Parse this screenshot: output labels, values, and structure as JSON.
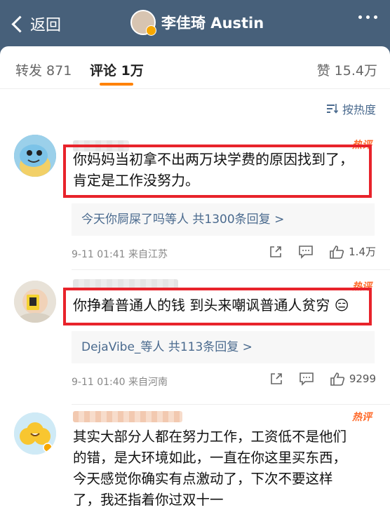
{
  "nav": {
    "back_label": "返回",
    "title": "李佳琦 Austin",
    "more_icon": "more-dots-icon"
  },
  "tabs": {
    "repost": "转发 871",
    "comments": "评论 1万",
    "likes": "赞 15.4万"
  },
  "sort_label": "按热度",
  "comments": [
    {
      "hot_label": "热评",
      "lines": [
        "你妈妈当初拿不出两万块学费的原因找到了，",
        "肯定是工作没努力。"
      ],
      "replies": "今天你屙屎了吗等人  共1300条回复 >",
      "meta": "9-11 01:41  来自江苏",
      "like_count": "1.4万"
    },
    {
      "hot_label": "热评",
      "lines": [
        "你挣着普通人的钱 到头来嘲讽普通人贫穷"
      ],
      "emoji": "😑",
      "replies": "DejaVibe_等人  共113条回复 >",
      "meta": "9-11 01:40  来自河南",
      "like_count": "9299"
    },
    {
      "hot_label": "热评",
      "lines": [
        "其实大部分人都在努力工作，工资低不是他们",
        "的错，是大环境如此，一直在你这里买东西，",
        "今天感觉你确实有点激动了，下次不要这样",
        "了，我还指着你过双十一"
      ]
    }
  ],
  "colors": {
    "nav_bg": "#47607a",
    "accent": "#ff8200",
    "highlight_box": "#e8232b",
    "link": "#4a6a8e"
  }
}
